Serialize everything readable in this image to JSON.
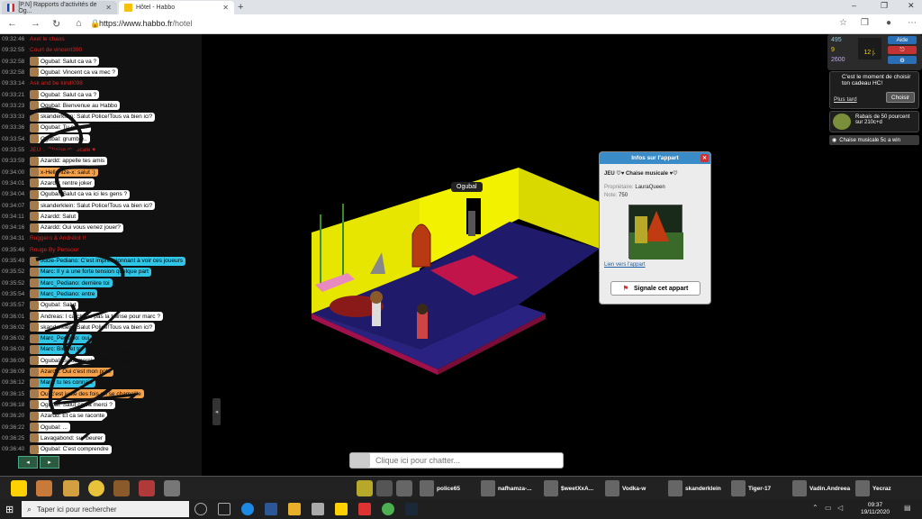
{
  "browser": {
    "tabs": [
      {
        "label": "[P.N] Rapports d'activités de Og..."
      },
      {
        "label": "Hôtel - Habbo"
      }
    ],
    "new_tab": "+",
    "url_domain": "https://www.habbo.fr",
    "url_path": "/hotel",
    "win_min": "–",
    "win_max": "❐",
    "win_close": "✕"
  },
  "chat": {
    "lines": [
      {
        "time": "09:32:46",
        "text": "Axel le chaos",
        "style": "red"
      },
      {
        "time": "09:32:55",
        "text": "Court de vincent390",
        "style": "red"
      },
      {
        "time": "09:32:58",
        "text": "Ogubal: Salut ca va ?",
        "style": "white"
      },
      {
        "time": "09:32:58",
        "text": "Ogubal: Vincent ca va mec ?",
        "style": "white"
      },
      {
        "time": "09:33:14",
        "text": "Ask and be kind!098",
        "style": "red"
      },
      {
        "time": "09:33:21",
        "text": "Ogubal: Salut ca va ?",
        "style": "white"
      },
      {
        "time": "09:33:23",
        "text": "Ogubal: Bienvenue au Habbo",
        "style": "white"
      },
      {
        "time": "09:33:33",
        "text": "skanderklein: Salut Police!Tous va bien ici?",
        "style": "white"
      },
      {
        "time": "09:33:36",
        "text": "Ogubal: Tu ca va?",
        "style": "white"
      },
      {
        "time": "09:33:54",
        "text": "Ogubal: grumble..",
        "style": "white"
      },
      {
        "time": "09:33:55",
        "text": "JEU ♥ Chaise musicale ♥",
        "style": "red"
      },
      {
        "time": "09:33:59",
        "text": "Azardd: appelle tes amis",
        "style": "white"
      },
      {
        "time": "09:34:00",
        "text": "x-Hello-ilze-x: salut :)",
        "style": "orange"
      },
      {
        "time": "09:34:01",
        "text": "Azardd: rentre joker",
        "style": "white"
      },
      {
        "time": "09:34:04",
        "text": "Ogubal: Salut ca va ici les gens ?",
        "style": "white"
      },
      {
        "time": "09:34:07",
        "text": "skanderklein: Salut Police!Tous va bien ici?",
        "style": "white"
      },
      {
        "time": "09:34:11",
        "text": "Azardd: Salut",
        "style": "white"
      },
      {
        "time": "09:34:16",
        "text": "Azardd: Oui vous venez jouer?",
        "style": "white"
      },
      {
        "time": "09:34:31",
        "text": "Ruggero & Andrélot !!",
        "style": "red"
      },
      {
        "time": "09:35:46",
        "text": "Rouge By Pensour",
        "style": "red"
      },
      {
        "time": "09:35:49",
        "text": "Jucie-Pediano: C'est impressionnant à voir ces joueurs",
        "style": "blue"
      },
      {
        "time": "09:35:52",
        "text": "Marc: Il y a une forte tension quelque part",
        "style": "blue"
      },
      {
        "time": "09:35:52",
        "text": "Marc_Pediano: derrière toi",
        "style": "blue"
      },
      {
        "time": "09:35:54",
        "text": "Marc_Pediano: entre",
        "style": "blue"
      },
      {
        "time": "09:35:57",
        "text": "Ogubal: Salut",
        "style": "white"
      },
      {
        "time": "09:36:01",
        "text": "Andreas: I catch tas pas la transe pour marc ?",
        "style": "white"
      },
      {
        "time": "09:36:02",
        "text": "skanderklein: Salut Police!Tous va bien ici?",
        "style": "white"
      },
      {
        "time": "09:36:02",
        "text": "Marc_Pediano: oui",
        "style": "blue"
      },
      {
        "time": "09:36:03",
        "text": "Marc: Bien et toi",
        "style": "blue"
      },
      {
        "time": "09:36:09",
        "text": "Ogubal: Salut merci",
        "style": "white"
      },
      {
        "time": "09:36:09",
        "text": "Azardd: Oui c'est mon pote",
        "style": "orange"
      },
      {
        "time": "09:36:12",
        "text": "Marc: tu les connais",
        "style": "blue"
      },
      {
        "time": "09:36:15",
        "text": "Oui c'est juste des fois on se chamaille",
        "style": "orange"
      },
      {
        "time": "09:36:18",
        "text": "Ogubal: Salut ca va merci ?",
        "style": "white"
      },
      {
        "time": "09:36:20",
        "text": "Azardd: Et ca se raconte",
        "style": "white"
      },
      {
        "time": "09:36:22",
        "text": "Ogubal: ...",
        "style": "white"
      },
      {
        "time": "09:36:25",
        "text": "Lavagabond: sur  beurer",
        "style": "white"
      },
      {
        "time": "09:36:40",
        "text": "Ogubal: C'est comprendre",
        "style": "white"
      }
    ]
  },
  "room": {
    "bubble_name": "Ogubal"
  },
  "hud": {
    "diamonds": "495",
    "credits": "9",
    "duckets": "2600",
    "hc_days": "12 j.",
    "help_label": "Aide",
    "colors": {
      "help": "#2a6fb5",
      "exit": "#c33333",
      "settings": "#2a6fb5"
    }
  },
  "notification": {
    "text": "C'est le moment de choisir ton cadeau HC!",
    "later": "Plus tard",
    "choose": "Choisir"
  },
  "offer": {
    "text": "Rabais de 50 pourcent sur 210c+d"
  },
  "room_tag": {
    "label": "Chaise musicale 5c a win"
  },
  "room_info": {
    "header": "Infos sur l'appart",
    "name": "JEU ♡♥ Chaise musicale ♥♡",
    "owner_label": "Propriétaire:",
    "owner": "LauraQueen",
    "rating_label": "Note:",
    "rating": "750",
    "link": "Lien vers l'appart",
    "report": "Signale cet appart"
  },
  "chat_input": {
    "placeholder": "Clique ici pour chatter..."
  },
  "friends": [
    {
      "name": "police65"
    },
    {
      "name": "nafhamza-..."
    },
    {
      "name": "$weetXxA..."
    },
    {
      "name": "Vodka-w"
    },
    {
      "name": "skanderklein"
    },
    {
      "name": "Tiger-17"
    },
    {
      "name": "Vadin.Andreea"
    },
    {
      "name": "Yecraz"
    }
  ],
  "taskbar": {
    "search": "Taper ici pour rechercher",
    "time": "09:37",
    "date": "19/11/2020"
  }
}
